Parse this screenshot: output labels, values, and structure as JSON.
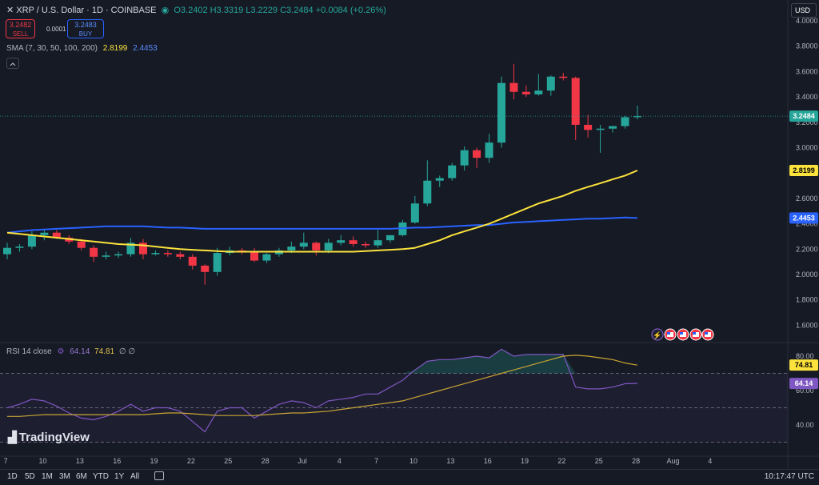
{
  "header": {
    "symbol": "XRP / U.S. Dollar · 1D · COINBASE",
    "ohlc": "O3.2402 H3.3319 L3.2229 C3.2484 +0.0084 (+0.26%)"
  },
  "trade": {
    "sell_price": "3.2482",
    "sell_label": "SELL",
    "spread": "0.0001",
    "buy_price": "3.2483",
    "buy_label": "BUY"
  },
  "sma": {
    "label": "SMA (7, 30, 50, 100, 200)",
    "v1": "2.8199",
    "v2": "2.4453"
  },
  "rsi": {
    "label": "RSI 14 close",
    "v1": "64.14",
    "v2": "74.81",
    "extra": "∅ ∅"
  },
  "currency": "USD",
  "brand": "TradingView",
  "timeframes": [
    "1D",
    "5D",
    "1M",
    "3M",
    "6M",
    "YTD",
    "1Y",
    "All"
  ],
  "clock": "10:17:47 UTC",
  "colors": {
    "up": "#26a69a",
    "down": "#f23645",
    "sma_fast": "#fbe23c",
    "sma_slow": "#2962ff",
    "rsi": "#7e57c2",
    "rsi_ma": "#c7a532"
  },
  "chart_data": {
    "type": "candlestick",
    "symbol": "XRP / U.S. Dollar",
    "interval": "1D",
    "y_ticks": [
      "1.6000",
      "1.8000",
      "2.0000",
      "2.2000",
      "2.4000",
      "2.6000",
      "2.8000",
      "3.0000",
      "3.2000",
      "3.4000",
      "3.6000",
      "3.8000",
      "4.0000"
    ],
    "ylim": [
      1.45,
      4.05
    ],
    "x_labels": [
      "7",
      "10",
      "13",
      "16",
      "19",
      "22",
      "25",
      "28",
      "Jul",
      "4",
      "7",
      "10",
      "13",
      "16",
      "19",
      "22",
      "25",
      "28",
      "Aug",
      "4"
    ],
    "last_price": "3.2484",
    "sma_labels": [
      "2.8199",
      "2.4453"
    ],
    "rsi_ticks": [
      "40.00",
      "60.00",
      "80.00"
    ],
    "rsi_labels": [
      "74.81",
      "64.14"
    ],
    "candles": [
      {
        "o": 2.16,
        "h": 2.25,
        "l": 2.12,
        "c": 2.21
      },
      {
        "o": 2.21,
        "h": 2.24,
        "l": 2.18,
        "c": 2.22
      },
      {
        "o": 2.22,
        "h": 2.34,
        "l": 2.2,
        "c": 2.31
      },
      {
        "o": 2.31,
        "h": 2.35,
        "l": 2.27,
        "c": 2.33
      },
      {
        "o": 2.33,
        "h": 2.35,
        "l": 2.28,
        "c": 2.29
      },
      {
        "o": 2.29,
        "h": 2.31,
        "l": 2.24,
        "c": 2.26
      },
      {
        "o": 2.26,
        "h": 2.28,
        "l": 2.19,
        "c": 2.21
      },
      {
        "o": 2.21,
        "h": 2.23,
        "l": 2.1,
        "c": 2.14
      },
      {
        "o": 2.14,
        "h": 2.18,
        "l": 2.12,
        "c": 2.15
      },
      {
        "o": 2.15,
        "h": 2.18,
        "l": 2.13,
        "c": 2.16
      },
      {
        "o": 2.16,
        "h": 2.29,
        "l": 2.14,
        "c": 2.25
      },
      {
        "o": 2.25,
        "h": 2.28,
        "l": 2.12,
        "c": 2.16
      },
      {
        "o": 2.16,
        "h": 2.19,
        "l": 2.15,
        "c": 2.17
      },
      {
        "o": 2.17,
        "h": 2.19,
        "l": 2.14,
        "c": 2.16
      },
      {
        "o": 2.16,
        "h": 2.18,
        "l": 2.12,
        "c": 2.14
      },
      {
        "o": 2.14,
        "h": 2.16,
        "l": 2.04,
        "c": 2.07
      },
      {
        "o": 2.07,
        "h": 2.08,
        "l": 1.92,
        "c": 2.02
      },
      {
        "o": 2.02,
        "h": 2.21,
        "l": 1.99,
        "c": 2.17
      },
      {
        "o": 2.17,
        "h": 2.22,
        "l": 2.15,
        "c": 2.19
      },
      {
        "o": 2.19,
        "h": 2.21,
        "l": 2.16,
        "c": 2.18
      },
      {
        "o": 2.18,
        "h": 2.21,
        "l": 2.1,
        "c": 2.11
      },
      {
        "o": 2.11,
        "h": 2.17,
        "l": 2.09,
        "c": 2.16
      },
      {
        "o": 2.16,
        "h": 2.21,
        "l": 2.14,
        "c": 2.19
      },
      {
        "o": 2.19,
        "h": 2.26,
        "l": 2.17,
        "c": 2.22
      },
      {
        "o": 2.22,
        "h": 2.33,
        "l": 2.2,
        "c": 2.25
      },
      {
        "o": 2.25,
        "h": 2.26,
        "l": 2.15,
        "c": 2.19
      },
      {
        "o": 2.19,
        "h": 2.28,
        "l": 2.17,
        "c": 2.25
      },
      {
        "o": 2.25,
        "h": 2.31,
        "l": 2.23,
        "c": 2.27
      },
      {
        "o": 2.27,
        "h": 2.3,
        "l": 2.22,
        "c": 2.24
      },
      {
        "o": 2.24,
        "h": 2.26,
        "l": 2.21,
        "c": 2.23
      },
      {
        "o": 2.23,
        "h": 2.35,
        "l": 2.21,
        "c": 2.27
      },
      {
        "o": 2.27,
        "h": 2.31,
        "l": 2.25,
        "c": 2.31
      },
      {
        "o": 2.31,
        "h": 2.43,
        "l": 2.3,
        "c": 2.41
      },
      {
        "o": 2.41,
        "h": 2.62,
        "l": 2.4,
        "c": 2.56
      },
      {
        "o": 2.56,
        "h": 2.9,
        "l": 2.54,
        "c": 2.74
      },
      {
        "o": 2.74,
        "h": 2.78,
        "l": 2.69,
        "c": 2.76
      },
      {
        "o": 2.76,
        "h": 2.88,
        "l": 2.74,
        "c": 2.86
      },
      {
        "o": 2.86,
        "h": 3.01,
        "l": 2.82,
        "c": 2.98
      },
      {
        "o": 2.98,
        "h": 3.0,
        "l": 2.84,
        "c": 2.92
      },
      {
        "o": 2.92,
        "h": 3.11,
        "l": 2.88,
        "c": 3.04
      },
      {
        "o": 3.04,
        "h": 3.56,
        "l": 3.0,
        "c": 3.51
      },
      {
        "o": 3.51,
        "h": 3.66,
        "l": 3.38,
        "c": 3.44
      },
      {
        "o": 3.44,
        "h": 3.49,
        "l": 3.4,
        "c": 3.42
      },
      {
        "o": 3.42,
        "h": 3.58,
        "l": 3.41,
        "c": 3.45
      },
      {
        "o": 3.45,
        "h": 3.57,
        "l": 3.41,
        "c": 3.56
      },
      {
        "o": 3.56,
        "h": 3.59,
        "l": 3.53,
        "c": 3.55
      },
      {
        "o": 3.55,
        "h": 3.56,
        "l": 3.06,
        "c": 3.18
      },
      {
        "o": 3.18,
        "h": 3.26,
        "l": 3.08,
        "c": 3.14
      },
      {
        "o": 3.14,
        "h": 3.18,
        "l": 2.96,
        "c": 3.15
      },
      {
        "o": 3.15,
        "h": 3.17,
        "l": 3.12,
        "c": 3.17
      },
      {
        "o": 3.17,
        "h": 3.25,
        "l": 3.15,
        "c": 3.24
      },
      {
        "o": 3.2402,
        "h": 3.3319,
        "l": 3.2229,
        "c": 3.2484
      }
    ],
    "sma_fast": [
      2.33,
      2.32,
      2.31,
      2.3,
      2.29,
      2.28,
      2.27,
      2.26,
      2.25,
      2.24,
      2.235,
      2.23,
      2.22,
      2.21,
      2.2,
      2.195,
      2.19,
      2.185,
      2.18,
      2.18,
      2.18,
      2.18,
      2.18,
      2.18,
      2.18,
      2.18,
      2.18,
      2.18,
      2.18,
      2.185,
      2.19,
      2.195,
      2.2,
      2.21,
      2.24,
      2.27,
      2.31,
      2.34,
      2.37,
      2.4,
      2.44,
      2.48,
      2.52,
      2.56,
      2.59,
      2.62,
      2.66,
      2.69,
      2.72,
      2.75,
      2.78,
      2.8199
    ],
    "sma_slow": [
      2.33,
      2.34,
      2.35,
      2.355,
      2.36,
      2.365,
      2.37,
      2.375,
      2.38,
      2.38,
      2.38,
      2.38,
      2.375,
      2.37,
      2.37,
      2.365,
      2.36,
      2.36,
      2.36,
      2.36,
      2.36,
      2.36,
      2.36,
      2.36,
      2.36,
      2.36,
      2.36,
      2.36,
      2.36,
      2.36,
      2.36,
      2.36,
      2.365,
      2.37,
      2.37,
      2.375,
      2.38,
      2.385,
      2.39,
      2.39,
      2.4,
      2.41,
      2.415,
      2.42,
      2.425,
      2.43,
      2.435,
      2.44,
      2.44,
      2.445,
      2.45,
      2.4453
    ],
    "rsi": [
      50,
      52,
      55,
      54,
      51,
      47,
      44,
      43,
      45,
      48,
      52,
      48,
      50,
      50,
      48,
      42,
      36,
      48,
      50,
      50,
      44,
      48,
      52,
      54,
      53,
      50,
      54,
      55,
      56,
      58,
      58,
      62,
      66,
      72,
      77,
      78,
      78,
      79,
      80,
      79,
      84,
      80,
      81,
      81,
      81,
      81,
      62,
      61,
      61,
      62,
      64,
      64.14
    ],
    "rsi_ma": [
      45,
      45,
      45.5,
      46,
      46,
      46,
      46,
      46,
      46,
      46,
      46,
      46,
      46.5,
      47,
      47,
      46.5,
      46,
      45.5,
      45.5,
      45.5,
      45.5,
      46,
      46.5,
      47,
      47,
      47.5,
      48,
      49,
      50,
      51,
      52,
      53,
      54,
      56,
      58,
      60,
      62,
      64,
      66,
      68,
      70,
      72,
      74,
      76,
      78,
      80,
      80.5,
      80,
      79,
      78,
      76,
      74.81
    ]
  }
}
